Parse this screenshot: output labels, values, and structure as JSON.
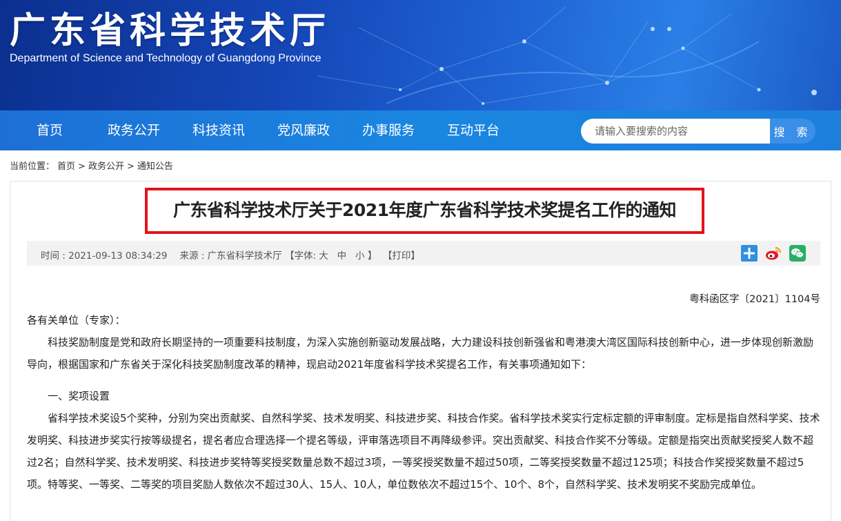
{
  "header": {
    "title": "广东省科学技术厅",
    "subtitle": "Department of Science and Technology of Guangdong Province"
  },
  "nav": {
    "items": [
      "首页",
      "政务公开",
      "科技资讯",
      "党风廉政",
      "办事服务",
      "互动平台"
    ],
    "search_placeholder": "请输入要搜索的内容",
    "search_button": "搜 索"
  },
  "breadcrumb": {
    "prefix": "当前位置：",
    "items": [
      "首页",
      "政务公开",
      "通知公告"
    ],
    "separator": ">"
  },
  "article": {
    "title": "广东省科学技术厅关于2021年度广东省科学技术奖提名工作的通知",
    "meta": {
      "time": "时间 : 2021-09-13 08:34:29",
      "source": "来源 : 广东省科学技术厅",
      "font_label": "【字体: 大",
      "font_mid": "中",
      "font_small": "小 】",
      "print": "【打印】"
    },
    "share_icons": [
      "plus-share-icon",
      "weibo-icon",
      "wechat-icon"
    ],
    "doc_number": "粤科函区字〔2021〕1104号",
    "salutation": "各有关单位（专家）：",
    "intro": "科技奖励制度是党和政府长期坚持的一项重要科技制度，为深入实施创新驱动发展战略，大力建设科技创新强省和粤港澳大湾区国际科技创新中心，进一步体现创新激励导向，根据国家和广东省关于深化科技奖励制度改革的精神，现启动2021年度省科学技术奖提名工作，有关事项通知如下：",
    "section1_heading": "一、奖项设置",
    "section1_body": "省科学技术奖设5个奖种，分别为突出贡献奖、自然科学奖、技术发明奖、科技进步奖、科技合作奖。省科学技术奖实行定标定额的评审制度。定标是指自然科学奖、技术发明奖、科技进步奖实行按等级提名，提名者应合理选择一个提名等级，评审落选项目不再降级参评。突出贡献奖、科技合作奖不分等级。定额是指突出贡献奖授奖人数不超过2名；自然科学奖、技术发明奖、科技进步奖特等奖授奖数量总数不超过3项，一等奖授奖数量不超过50项，二等奖授奖数量不超过125项；科技合作奖授奖数量不超过5项。特等奖、一等奖、二等奖的项目奖励人数依次不超过30人、15人、10人，单位数依次不超过15个、10个、8个，自然科学奖、技术发明奖不奖励完成单位。"
  },
  "colors": {
    "banner_dark": "#0b2f8f",
    "nav_blue": "#1a86e0",
    "title_border": "#e3121b",
    "meta_bg": "#f2f2f2"
  }
}
